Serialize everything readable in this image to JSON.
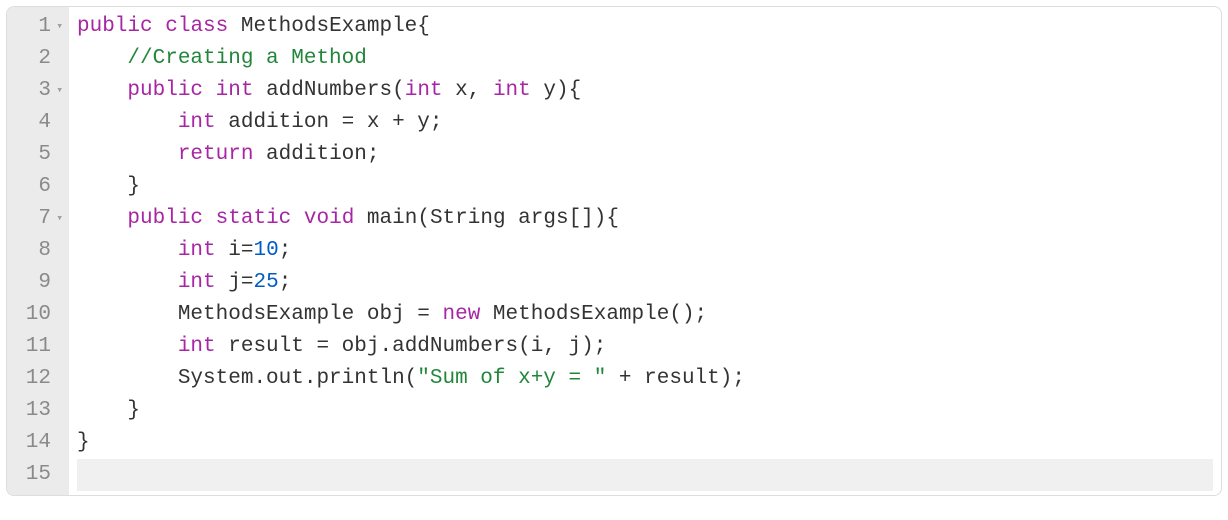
{
  "editor": {
    "gutter": [
      {
        "num": "1",
        "fold": "▾"
      },
      {
        "num": "2",
        "fold": " "
      },
      {
        "num": "3",
        "fold": "▾"
      },
      {
        "num": "4",
        "fold": " "
      },
      {
        "num": "5",
        "fold": " "
      },
      {
        "num": "6",
        "fold": " "
      },
      {
        "num": "7",
        "fold": "▾"
      },
      {
        "num": "8",
        "fold": " "
      },
      {
        "num": "9",
        "fold": " "
      },
      {
        "num": "10",
        "fold": " "
      },
      {
        "num": "11",
        "fold": " "
      },
      {
        "num": "12",
        "fold": " "
      },
      {
        "num": "13",
        "fold": " "
      },
      {
        "num": "14",
        "fold": " "
      },
      {
        "num": "15",
        "fold": " "
      }
    ],
    "lines": [
      [
        {
          "t": "public",
          "c": "kw"
        },
        {
          "t": " ",
          "c": "plain"
        },
        {
          "t": "class",
          "c": "kw"
        },
        {
          "t": " ",
          "c": "plain"
        },
        {
          "t": "MethodsExample",
          "c": "cls"
        },
        {
          "t": "{",
          "c": "pun"
        }
      ],
      [
        {
          "t": "    ",
          "c": "plain"
        },
        {
          "t": "//Creating a Method",
          "c": "cmt"
        }
      ],
      [
        {
          "t": "    ",
          "c": "plain"
        },
        {
          "t": "public",
          "c": "kw"
        },
        {
          "t": " ",
          "c": "plain"
        },
        {
          "t": "int",
          "c": "kw"
        },
        {
          "t": " ",
          "c": "plain"
        },
        {
          "t": "addNumbers",
          "c": "fn"
        },
        {
          "t": "(",
          "c": "pun"
        },
        {
          "t": "int",
          "c": "kw"
        },
        {
          "t": " x, ",
          "c": "plain"
        },
        {
          "t": "int",
          "c": "kw"
        },
        {
          "t": " y",
          "c": "plain"
        },
        {
          "t": "){",
          "c": "pun"
        }
      ],
      [
        {
          "t": "        ",
          "c": "plain"
        },
        {
          "t": "int",
          "c": "kw"
        },
        {
          "t": " addition ",
          "c": "plain"
        },
        {
          "t": "=",
          "c": "pun"
        },
        {
          "t": " x ",
          "c": "plain"
        },
        {
          "t": "+",
          "c": "pun"
        },
        {
          "t": " y",
          "c": "plain"
        },
        {
          "t": ";",
          "c": "pun"
        }
      ],
      [
        {
          "t": "        ",
          "c": "plain"
        },
        {
          "t": "return",
          "c": "kw"
        },
        {
          "t": " addition",
          "c": "plain"
        },
        {
          "t": ";",
          "c": "pun"
        }
      ],
      [
        {
          "t": "    ",
          "c": "plain"
        },
        {
          "t": "}",
          "c": "pun"
        }
      ],
      [
        {
          "t": "    ",
          "c": "plain"
        },
        {
          "t": "public",
          "c": "kw"
        },
        {
          "t": " ",
          "c": "plain"
        },
        {
          "t": "static",
          "c": "kw"
        },
        {
          "t": " ",
          "c": "plain"
        },
        {
          "t": "void",
          "c": "kw"
        },
        {
          "t": " ",
          "c": "plain"
        },
        {
          "t": "main",
          "c": "fn"
        },
        {
          "t": "(",
          "c": "pun"
        },
        {
          "t": "String args",
          "c": "plain"
        },
        {
          "t": "[]){",
          "c": "pun"
        }
      ],
      [
        {
          "t": "        ",
          "c": "plain"
        },
        {
          "t": "int",
          "c": "kw"
        },
        {
          "t": " i",
          "c": "plain"
        },
        {
          "t": "=",
          "c": "pun"
        },
        {
          "t": "10",
          "c": "num"
        },
        {
          "t": ";",
          "c": "pun"
        }
      ],
      [
        {
          "t": "        ",
          "c": "plain"
        },
        {
          "t": "int",
          "c": "kw"
        },
        {
          "t": " j",
          "c": "plain"
        },
        {
          "t": "=",
          "c": "pun"
        },
        {
          "t": "25",
          "c": "num"
        },
        {
          "t": ";",
          "c": "pun"
        }
      ],
      [
        {
          "t": "        ",
          "c": "plain"
        },
        {
          "t": "MethodsExample obj ",
          "c": "plain"
        },
        {
          "t": "=",
          "c": "pun"
        },
        {
          "t": " ",
          "c": "plain"
        },
        {
          "t": "new",
          "c": "kw"
        },
        {
          "t": " MethodsExample",
          "c": "plain"
        },
        {
          "t": "();",
          "c": "pun"
        }
      ],
      [
        {
          "t": "        ",
          "c": "plain"
        },
        {
          "t": "int",
          "c": "kw"
        },
        {
          "t": " result ",
          "c": "plain"
        },
        {
          "t": "=",
          "c": "pun"
        },
        {
          "t": " obj.addNumbers",
          "c": "plain"
        },
        {
          "t": "(",
          "c": "pun"
        },
        {
          "t": "i, j",
          "c": "plain"
        },
        {
          "t": ");",
          "c": "pun"
        }
      ],
      [
        {
          "t": "        ",
          "c": "plain"
        },
        {
          "t": "System.out.println",
          "c": "plain"
        },
        {
          "t": "(",
          "c": "pun"
        },
        {
          "t": "\"Sum of x+y = \"",
          "c": "str"
        },
        {
          "t": " ",
          "c": "plain"
        },
        {
          "t": "+",
          "c": "pun"
        },
        {
          "t": " result",
          "c": "plain"
        },
        {
          "t": ");",
          "c": "pun"
        }
      ],
      [
        {
          "t": "    ",
          "c": "plain"
        },
        {
          "t": "}",
          "c": "pun"
        }
      ],
      [
        {
          "t": "}",
          "c": "pun"
        }
      ],
      [
        {
          "t": "",
          "c": "plain"
        }
      ]
    ],
    "active_line_index": 14
  }
}
